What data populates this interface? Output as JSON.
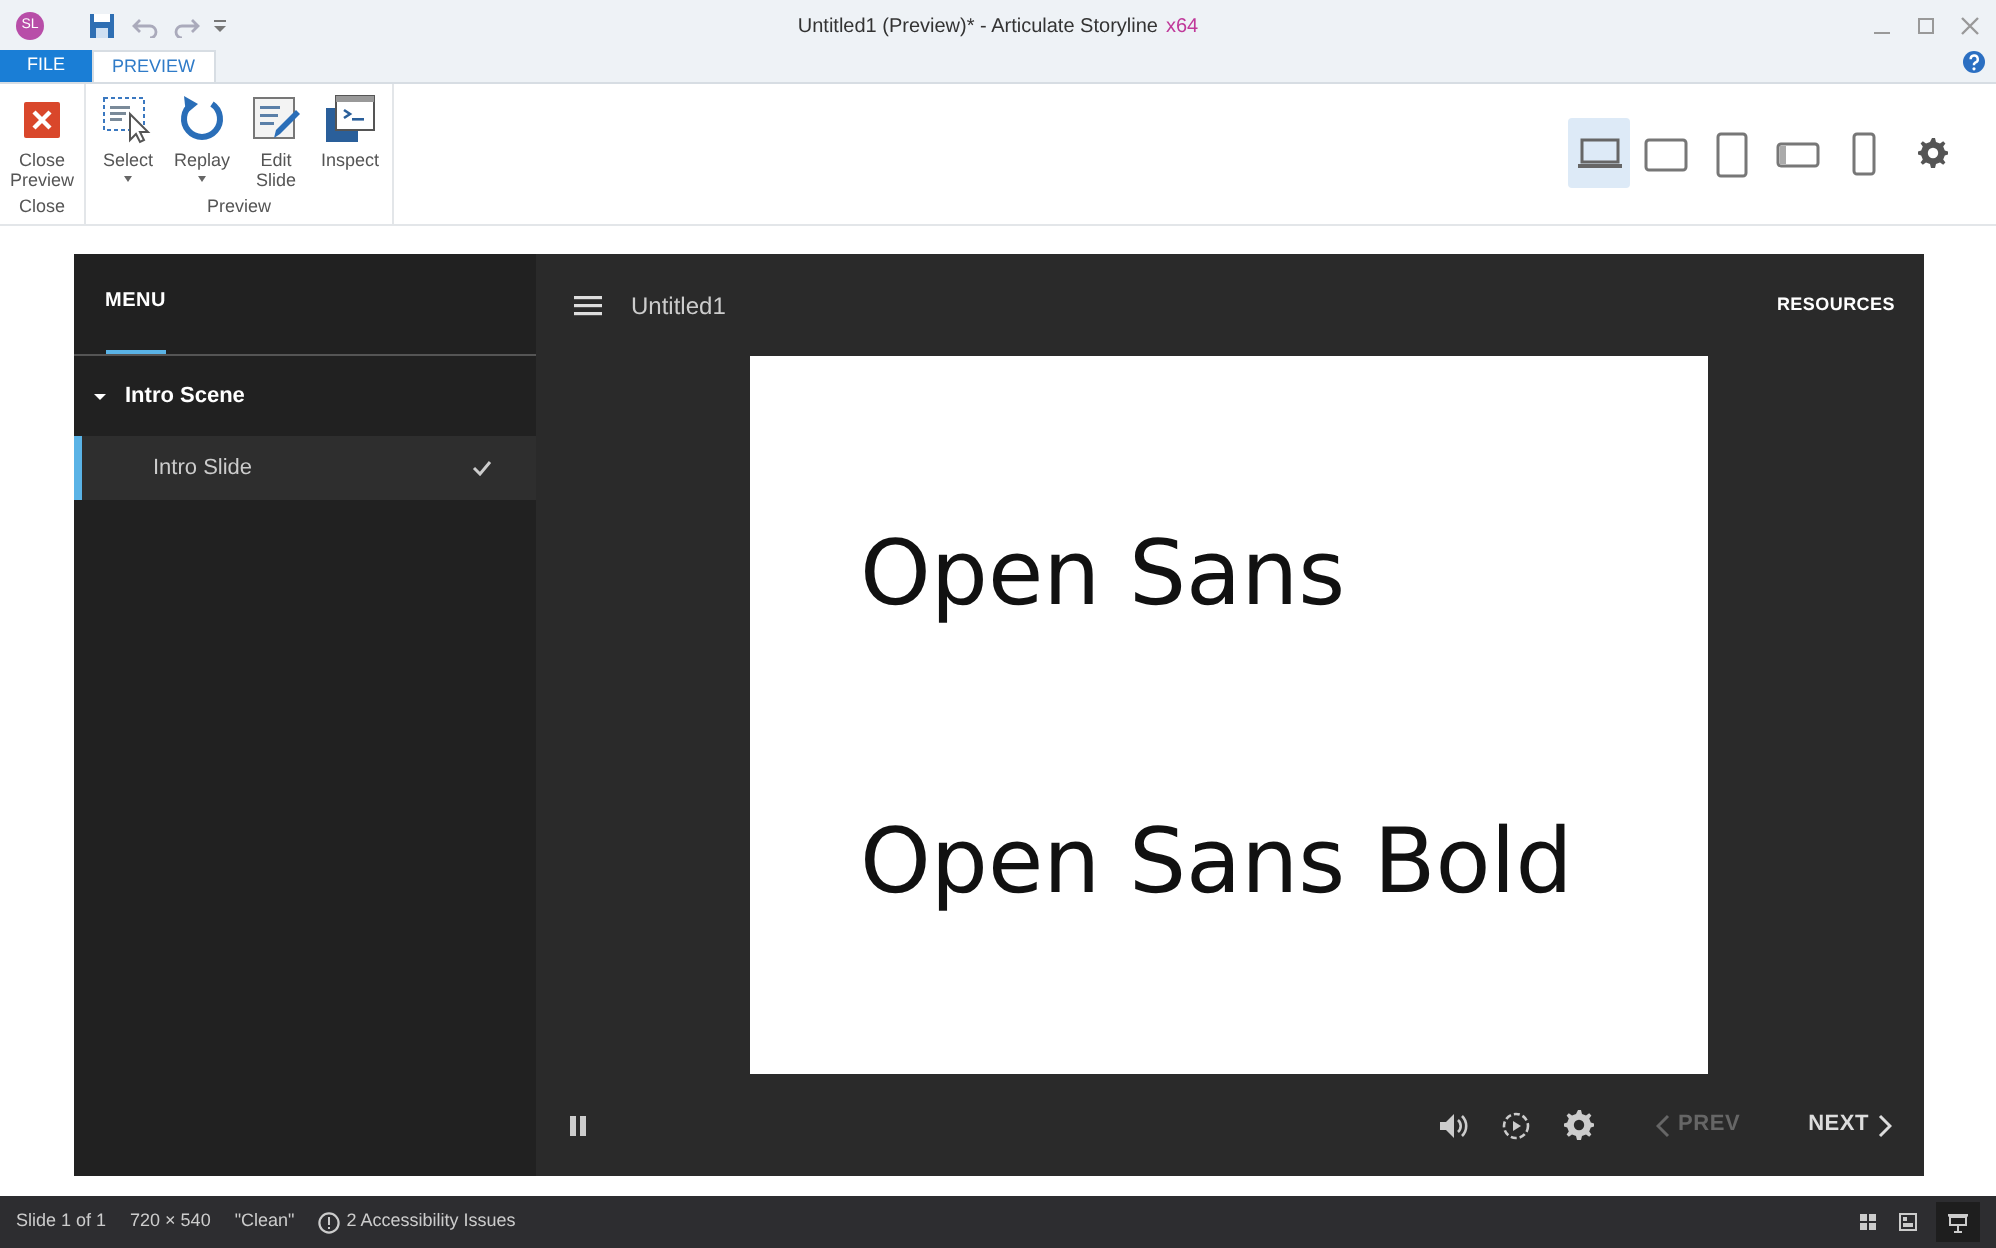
{
  "window": {
    "title": "Untitled1 (Preview)* -  Articulate Storyline",
    "edition": "x64",
    "app_badge": "SL"
  },
  "ribbon_tabs": [
    {
      "label": "FILE",
      "kind": "file",
      "selected": false
    },
    {
      "label": "PREVIEW",
      "kind": "tab",
      "selected": true
    }
  ],
  "ribbon_groups": [
    {
      "label": "Close",
      "buttons": [
        {
          "label": "Close Preview",
          "kind": "close",
          "dropdown": false
        }
      ]
    },
    {
      "label": "Preview",
      "buttons": [
        {
          "label": "Select",
          "kind": "select",
          "dropdown": true
        },
        {
          "label": "Replay",
          "kind": "replay",
          "dropdown": true
        },
        {
          "label": "Edit Slide",
          "kind": "edit",
          "dropdown": false
        },
        {
          "label": "Inspect",
          "kind": "inspect",
          "dropdown": false
        }
      ]
    }
  ],
  "devices": [
    {
      "kind": "desktop",
      "selected": true
    },
    {
      "kind": "tablet-landscape",
      "selected": false
    },
    {
      "kind": "tablet-portrait",
      "selected": false
    },
    {
      "kind": "phone-landscape",
      "selected": false
    },
    {
      "kind": "phone-portrait",
      "selected": false
    }
  ],
  "player": {
    "menu_tab": "MENU",
    "scenes": [
      {
        "title": "Intro Scene",
        "expanded": true,
        "children": [
          {
            "title": "Intro Slide",
            "selected": true,
            "visited": true
          }
        ]
      }
    ],
    "course_title": "Untitled1",
    "resources": "RESOURCES",
    "slide_texts": [
      "Open Sans",
      "Open Sans Bold"
    ],
    "prev": {
      "label": "PREV",
      "disabled": true
    },
    "next": {
      "label": "NEXT",
      "disabled": false
    }
  },
  "status_bar": {
    "slide": "Slide 1 of 1",
    "size": "720 × 540",
    "theme": "\"Clean\"",
    "accessibility": "2 Accessibility Issues"
  }
}
